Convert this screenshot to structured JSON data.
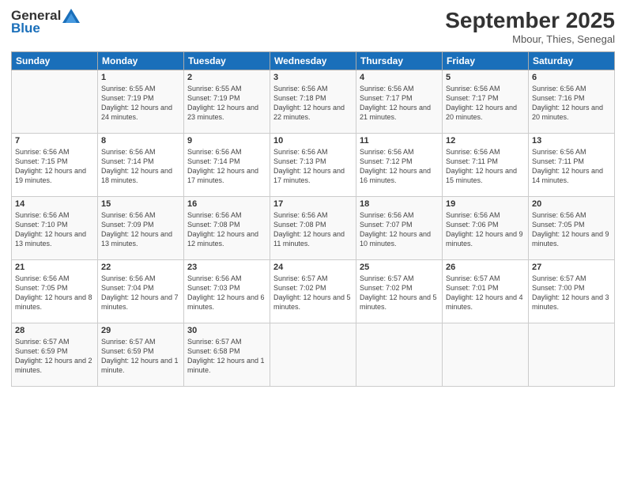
{
  "header": {
    "logo_general": "General",
    "logo_blue": "Blue",
    "month_title": "September 2025",
    "subtitle": "Mbour, Thies, Senegal"
  },
  "days_of_week": [
    "Sunday",
    "Monday",
    "Tuesday",
    "Wednesday",
    "Thursday",
    "Friday",
    "Saturday"
  ],
  "weeks": [
    [
      {
        "day": "",
        "sunrise": "",
        "sunset": "",
        "daylight": ""
      },
      {
        "day": "1",
        "sunrise": "Sunrise: 6:55 AM",
        "sunset": "Sunset: 7:19 PM",
        "daylight": "Daylight: 12 hours and 24 minutes."
      },
      {
        "day": "2",
        "sunrise": "Sunrise: 6:55 AM",
        "sunset": "Sunset: 7:19 PM",
        "daylight": "Daylight: 12 hours and 23 minutes."
      },
      {
        "day": "3",
        "sunrise": "Sunrise: 6:56 AM",
        "sunset": "Sunset: 7:18 PM",
        "daylight": "Daylight: 12 hours and 22 minutes."
      },
      {
        "day": "4",
        "sunrise": "Sunrise: 6:56 AM",
        "sunset": "Sunset: 7:17 PM",
        "daylight": "Daylight: 12 hours and 21 minutes."
      },
      {
        "day": "5",
        "sunrise": "Sunrise: 6:56 AM",
        "sunset": "Sunset: 7:17 PM",
        "daylight": "Daylight: 12 hours and 20 minutes."
      },
      {
        "day": "6",
        "sunrise": "Sunrise: 6:56 AM",
        "sunset": "Sunset: 7:16 PM",
        "daylight": "Daylight: 12 hours and 20 minutes."
      }
    ],
    [
      {
        "day": "7",
        "sunrise": "Sunrise: 6:56 AM",
        "sunset": "Sunset: 7:15 PM",
        "daylight": "Daylight: 12 hours and 19 minutes."
      },
      {
        "day": "8",
        "sunrise": "Sunrise: 6:56 AM",
        "sunset": "Sunset: 7:14 PM",
        "daylight": "Daylight: 12 hours and 18 minutes."
      },
      {
        "day": "9",
        "sunrise": "Sunrise: 6:56 AM",
        "sunset": "Sunset: 7:14 PM",
        "daylight": "Daylight: 12 hours and 17 minutes."
      },
      {
        "day": "10",
        "sunrise": "Sunrise: 6:56 AM",
        "sunset": "Sunset: 7:13 PM",
        "daylight": "Daylight: 12 hours and 17 minutes."
      },
      {
        "day": "11",
        "sunrise": "Sunrise: 6:56 AM",
        "sunset": "Sunset: 7:12 PM",
        "daylight": "Daylight: 12 hours and 16 minutes."
      },
      {
        "day": "12",
        "sunrise": "Sunrise: 6:56 AM",
        "sunset": "Sunset: 7:11 PM",
        "daylight": "Daylight: 12 hours and 15 minutes."
      },
      {
        "day": "13",
        "sunrise": "Sunrise: 6:56 AM",
        "sunset": "Sunset: 7:11 PM",
        "daylight": "Daylight: 12 hours and 14 minutes."
      }
    ],
    [
      {
        "day": "14",
        "sunrise": "Sunrise: 6:56 AM",
        "sunset": "Sunset: 7:10 PM",
        "daylight": "Daylight: 12 hours and 13 minutes."
      },
      {
        "day": "15",
        "sunrise": "Sunrise: 6:56 AM",
        "sunset": "Sunset: 7:09 PM",
        "daylight": "Daylight: 12 hours and 13 minutes."
      },
      {
        "day": "16",
        "sunrise": "Sunrise: 6:56 AM",
        "sunset": "Sunset: 7:08 PM",
        "daylight": "Daylight: 12 hours and 12 minutes."
      },
      {
        "day": "17",
        "sunrise": "Sunrise: 6:56 AM",
        "sunset": "Sunset: 7:08 PM",
        "daylight": "Daylight: 12 hours and 11 minutes."
      },
      {
        "day": "18",
        "sunrise": "Sunrise: 6:56 AM",
        "sunset": "Sunset: 7:07 PM",
        "daylight": "Daylight: 12 hours and 10 minutes."
      },
      {
        "day": "19",
        "sunrise": "Sunrise: 6:56 AM",
        "sunset": "Sunset: 7:06 PM",
        "daylight": "Daylight: 12 hours and 9 minutes."
      },
      {
        "day": "20",
        "sunrise": "Sunrise: 6:56 AM",
        "sunset": "Sunset: 7:05 PM",
        "daylight": "Daylight: 12 hours and 9 minutes."
      }
    ],
    [
      {
        "day": "21",
        "sunrise": "Sunrise: 6:56 AM",
        "sunset": "Sunset: 7:05 PM",
        "daylight": "Daylight: 12 hours and 8 minutes."
      },
      {
        "day": "22",
        "sunrise": "Sunrise: 6:56 AM",
        "sunset": "Sunset: 7:04 PM",
        "daylight": "Daylight: 12 hours and 7 minutes."
      },
      {
        "day": "23",
        "sunrise": "Sunrise: 6:56 AM",
        "sunset": "Sunset: 7:03 PM",
        "daylight": "Daylight: 12 hours and 6 minutes."
      },
      {
        "day": "24",
        "sunrise": "Sunrise: 6:57 AM",
        "sunset": "Sunset: 7:02 PM",
        "daylight": "Daylight: 12 hours and 5 minutes."
      },
      {
        "day": "25",
        "sunrise": "Sunrise: 6:57 AM",
        "sunset": "Sunset: 7:02 PM",
        "daylight": "Daylight: 12 hours and 5 minutes."
      },
      {
        "day": "26",
        "sunrise": "Sunrise: 6:57 AM",
        "sunset": "Sunset: 7:01 PM",
        "daylight": "Daylight: 12 hours and 4 minutes."
      },
      {
        "day": "27",
        "sunrise": "Sunrise: 6:57 AM",
        "sunset": "Sunset: 7:00 PM",
        "daylight": "Daylight: 12 hours and 3 minutes."
      }
    ],
    [
      {
        "day": "28",
        "sunrise": "Sunrise: 6:57 AM",
        "sunset": "Sunset: 6:59 PM",
        "daylight": "Daylight: 12 hours and 2 minutes."
      },
      {
        "day": "29",
        "sunrise": "Sunrise: 6:57 AM",
        "sunset": "Sunset: 6:59 PM",
        "daylight": "Daylight: 12 hours and 1 minute."
      },
      {
        "day": "30",
        "sunrise": "Sunrise: 6:57 AM",
        "sunset": "Sunset: 6:58 PM",
        "daylight": "Daylight: 12 hours and 1 minute."
      },
      {
        "day": "",
        "sunrise": "",
        "sunset": "",
        "daylight": ""
      },
      {
        "day": "",
        "sunrise": "",
        "sunset": "",
        "daylight": ""
      },
      {
        "day": "",
        "sunrise": "",
        "sunset": "",
        "daylight": ""
      },
      {
        "day": "",
        "sunrise": "",
        "sunset": "",
        "daylight": ""
      }
    ]
  ]
}
